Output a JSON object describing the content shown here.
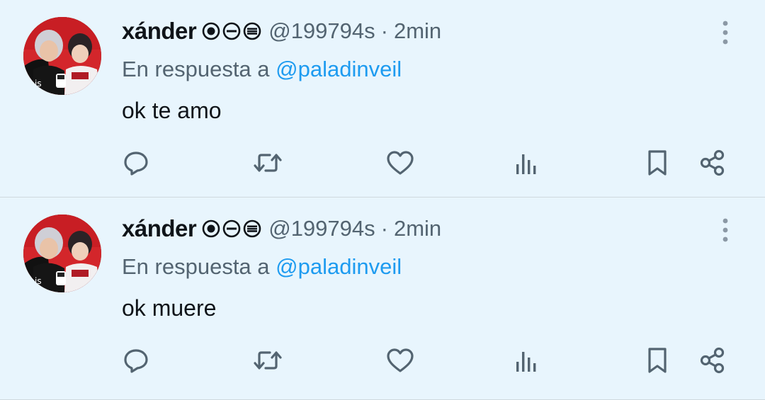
{
  "colors": {
    "background": "#e8f5fd",
    "text": "#0f1419",
    "secondary": "#536471",
    "link": "#1d9bf0",
    "divider": "#cfd9de"
  },
  "tweets": [
    {
      "author": {
        "name": "xánder",
        "name_emoji": [
          "record-button-emoji",
          "minus-circle-emoji",
          "equals-circle-emoji"
        ],
        "handle": "@199794s"
      },
      "separator": "·",
      "time": "2min",
      "reply_prefix": "En respuesta a",
      "reply_to": "@paladinveil",
      "text": "ok te amo",
      "actions": [
        "reply-icon",
        "retweet-icon",
        "like-icon",
        "views-icon",
        "bookmark-icon",
        "share-icon"
      ]
    },
    {
      "author": {
        "name": "xánder",
        "name_emoji": [
          "record-button-emoji",
          "minus-circle-emoji",
          "equals-circle-emoji"
        ],
        "handle": "@199794s"
      },
      "separator": "·",
      "time": "2min",
      "reply_prefix": "En respuesta a",
      "reply_to": "@paladinveil",
      "text": "ok muere",
      "actions": [
        "reply-icon",
        "retweet-icon",
        "like-icon",
        "views-icon",
        "bookmark-icon",
        "share-icon"
      ]
    }
  ]
}
